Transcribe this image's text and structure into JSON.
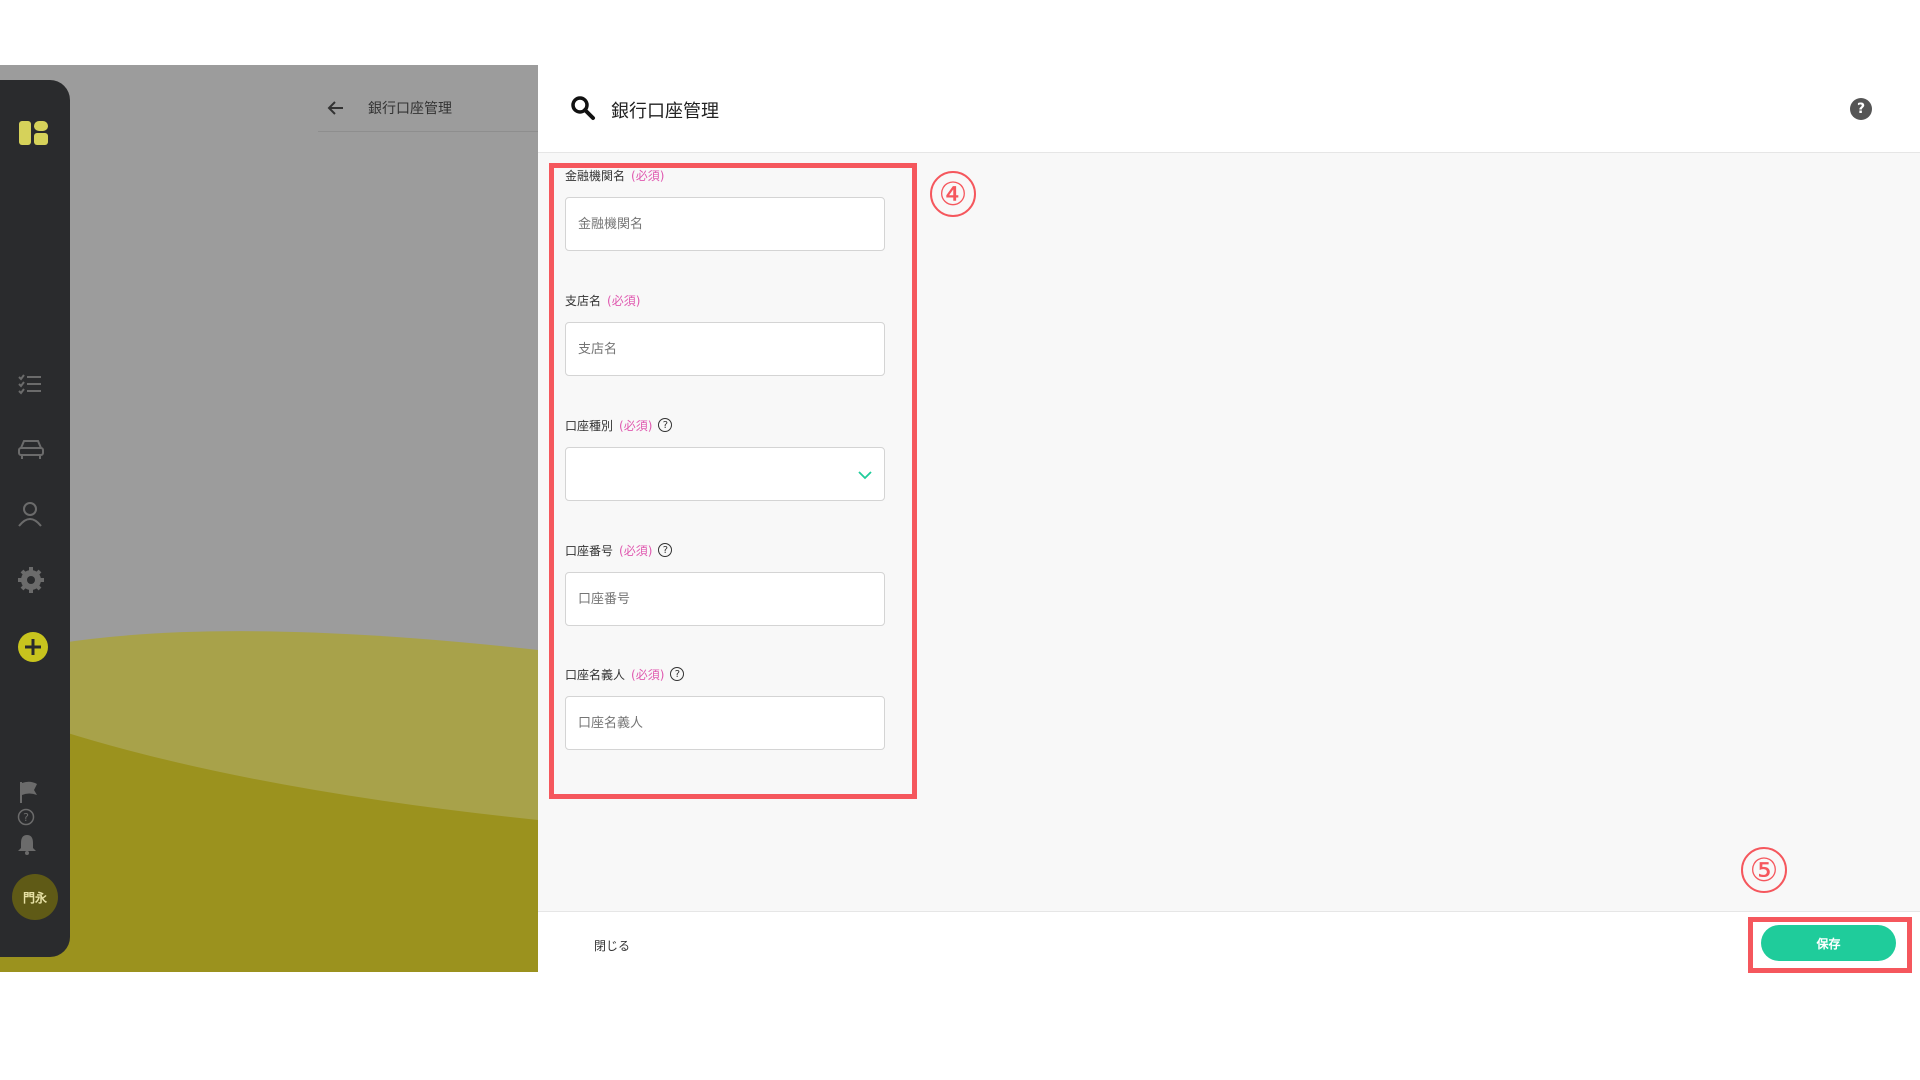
{
  "background": {
    "back_arrow_icon": "arrow-left-icon",
    "page_title": "銀行口座管理"
  },
  "sidebar": {
    "icons": [
      "logo-icon",
      "checklist-icon",
      "car-icon",
      "user-icon",
      "gear-icon",
      "plus-circle-icon",
      "flag-icon",
      "question-icon",
      "bell-icon"
    ],
    "avatar_text": "門永"
  },
  "panel": {
    "title": "銀行口座管理",
    "help_text": "?",
    "form": {
      "required_text": "(必須)",
      "fields": [
        {
          "label": "金融機関名",
          "placeholder": "金融機関名"
        },
        {
          "label": "支店名",
          "placeholder": "支店名"
        },
        {
          "label": "口座種別",
          "placeholder": ""
        },
        {
          "label": "口座番号",
          "placeholder": "口座番号"
        },
        {
          "label": "口座名義人",
          "placeholder": "口座名義人"
        }
      ]
    },
    "footer": {
      "close_label": "閉じる",
      "save_label": "保存"
    }
  },
  "annotations": {
    "form_marker": "④",
    "save_marker": "⑤",
    "color": "#f5575d"
  },
  "colors": {
    "accent": "#1fcc9b",
    "required": "#e05ab0",
    "sidebar": "#2a2b2d",
    "olive": "#9b921e"
  }
}
